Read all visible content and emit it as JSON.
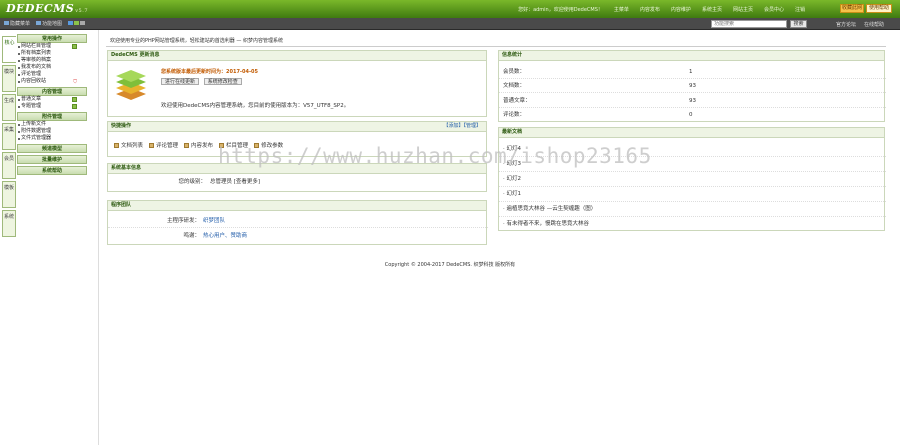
{
  "brand": {
    "logo": "DEDECMS",
    "version": "v5.7"
  },
  "topbar": {
    "links": [
      "您好：admin，欢迎使用DedeCMS！",
      "主菜单",
      "内容发布",
      "内容维护",
      "系统主页",
      "网站主页",
      "会员中心",
      "注销"
    ],
    "btn_favorite": "收藏此网",
    "btn_help": "使用帮助"
  },
  "subbar": {
    "left": [
      "隐藏菜单",
      "功能地图"
    ],
    "search_placeholder": "功能搜索",
    "search_value": "功能搜索",
    "search_btn": "搜索",
    "right": [
      "官方论坛",
      "在线帮助"
    ]
  },
  "lefttabs": [
    "核心",
    "模块",
    "生成",
    "采集",
    "会员",
    "模板",
    "系统"
  ],
  "menu": [
    {
      "title": "常用操作",
      "items": [
        {
          "label": "网站栏目管理",
          "icon": "plus"
        },
        {
          "label": "所有档案列表",
          "icon": ""
        },
        {
          "label": "等审核的档案",
          "icon": ""
        },
        {
          "label": "我发布的文档",
          "icon": ""
        },
        {
          "label": "评论管理",
          "icon": ""
        },
        {
          "label": "内容回收站",
          "icon": "shield"
        }
      ]
    },
    {
      "title": "内容管理",
      "items": [
        {
          "label": "普通文章",
          "icon": "plus"
        },
        {
          "label": "专题管理",
          "icon": "plus"
        }
      ]
    },
    {
      "title": "附件管理",
      "items": [
        {
          "label": "上传新文件",
          "icon": ""
        },
        {
          "label": "附件数据管理",
          "icon": ""
        },
        {
          "label": "文件式管理器",
          "icon": ""
        }
      ]
    },
    {
      "title": "频道模型",
      "items": []
    },
    {
      "title": "批量维护",
      "items": []
    },
    {
      "title": "系统帮助",
      "items": []
    }
  ],
  "welcome": {
    "text": "欢迎使用专业的PHP网站管理系统，轻松建站的首选利器 — 织梦内容管理系统"
  },
  "update_panel": {
    "title": "DedeCMS 更新消息",
    "date_line": "您系统版本最后更新时间为：2017-04-05",
    "btn_online": "进行在线更新",
    "btn_check": "系统修改检查",
    "msg": "欢迎使用DedeCMS内容管理系统，您目前的使用版本为：V57_UTF8_SP2。"
  },
  "quick_panel": {
    "title": "快捷操作",
    "right": "【添加】【管理】",
    "items": [
      "文档列表",
      "评论管理",
      "内容发布",
      "栏目管理",
      "修改参数"
    ]
  },
  "sysinfo_panel": {
    "title": "系统基本信息",
    "label": "您的级别：",
    "value": "总管理员 [查看更多]"
  },
  "team_panel": {
    "title": "程序团队",
    "rows": [
      {
        "label": "主程序研发：",
        "value": "织梦团队"
      },
      {
        "label": "鸣谢：",
        "value": "热心用户、赞助商"
      }
    ]
  },
  "stats_panel": {
    "title": "信息统计",
    "rows": [
      {
        "label": "会员数：",
        "value": "1"
      },
      {
        "label": "文档数：",
        "value": "93"
      },
      {
        "label": "普通文章：",
        "value": "93"
      },
      {
        "label": "评论数：",
        "value": "0"
      }
    ]
  },
  "recent_panel": {
    "title": "最新文档",
    "items": [
      "幻灯4",
      "幻灯3",
      "幻灯2",
      "幻灯1",
      "遍植思竟大林谷 —云生契缠趣（图）",
      "有未得者不来，慢跳在思竟大林谷"
    ]
  },
  "footer": {
    "text": "Copyright © 2004-2017 DedeCMS. 织梦科技 版权所有"
  },
  "watermark": {
    "text": "https://www.huzhan.com/ishop23165"
  }
}
